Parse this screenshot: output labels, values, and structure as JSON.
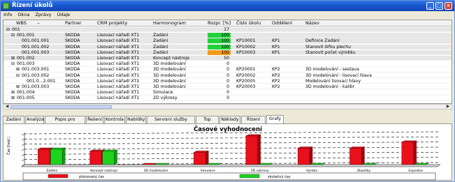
{
  "window": {
    "title": "Řízení úkolů",
    "controls": {
      "minimize": "_",
      "maximize": "□",
      "close": "×"
    }
  },
  "menu": [
    "Info",
    "Okna",
    "Zprávy",
    "Údaje"
  ],
  "grid": {
    "columns": [
      "WBS",
      "Partner",
      "CRM projekty",
      "Harmonogram",
      "Rozpr. [%]",
      "Číslo úkolu",
      "Oddělení",
      "Název"
    ],
    "rows": [
      {
        "wbs": "001",
        "partner": "",
        "crm": "",
        "harm": "",
        "pct": "17",
        "num": "",
        "odd": "",
        "nazev": "",
        "ind": 0,
        "exp": "minus",
        "sel": true
      },
      {
        "wbs": "001.001",
        "partner": "SKODA",
        "crm": "Lisovací nářadí XT1",
        "harm": "Zadání",
        "pct": "100",
        "num": "",
        "odd": "",
        "nazev": "",
        "ind": 1,
        "exp": "minus",
        "sel": true,
        "bar": "green"
      },
      {
        "wbs": "001.001.001",
        "partner": "SKODA",
        "crm": "Lisovací nářadí XT1",
        "harm": "Zadání",
        "pct": "100",
        "num": "KP10001",
        "odd": "KP1",
        "nazev": "Definice Zadání",
        "ind": 2,
        "exp": "",
        "sel": true,
        "bar": "green"
      },
      {
        "wbs": "001.001.002",
        "partner": "SKODA",
        "crm": "Lisovací nářadí XT1",
        "harm": "Zadání",
        "pct": "100",
        "num": "KP10002",
        "odd": "KP1",
        "nazev": "Stanovit šířku plechu",
        "ind": 2,
        "exp": "",
        "sel": true,
        "bar": "green"
      },
      {
        "wbs": "001.001.003",
        "partner": "SKODA",
        "crm": "Lisovací nářadí XT1",
        "harm": "Zadání",
        "pct": "100",
        "num": "KP10003",
        "odd": "KP1",
        "nazev": "Stanovit počet výrobku",
        "ind": 2,
        "exp": "",
        "sel": true,
        "bar": "orange"
      },
      {
        "wbs": "001.002",
        "partner": "SKODA",
        "crm": "Lisovací nářadí XT1",
        "harm": "Koncept nástroje",
        "pct": "50",
        "num": "",
        "odd": "",
        "nazev": "",
        "ind": 1,
        "exp": "plus",
        "sel": true
      },
      {
        "wbs": "001.003",
        "partner": "SKODA",
        "crm": "Lisovací nářadí XT1",
        "harm": "3D modelování",
        "pct": "0",
        "num": "",
        "odd": "",
        "nazev": "",
        "ind": 1,
        "exp": "minus"
      },
      {
        "wbs": "001.003.001",
        "partner": "SKODA",
        "crm": "Lisovací nářadí XT1",
        "harm": "3D modelování",
        "pct": "0",
        "num": "KP20001",
        "odd": "KP2",
        "nazev": "3D modelování - sestava",
        "ind": 2,
        "exp": "plus"
      },
      {
        "wbs": "001.003.002",
        "partner": "SKODA",
        "crm": "Lisovací nářadí XT1",
        "harm": "3D modelování",
        "pct": "0",
        "num": "KP20002",
        "odd": "KP2",
        "nazev": "3D modelování - lisovací hlava",
        "ind": 2,
        "exp": "minus"
      },
      {
        "wbs": "001.0...2.001",
        "partner": "SKODA",
        "crm": "Lisovací nářadí XT1",
        "harm": "3D modelování",
        "pct": "0",
        "num": "KP20005",
        "odd": "KP2",
        "nazev": "Modelování lisovací hlavy",
        "ind": 3,
        "exp": ""
      },
      {
        "wbs": "001.003.003",
        "partner": "SKODA",
        "crm": "Lisovací nářadí XT1",
        "harm": "3D modelování",
        "pct": "0",
        "num": "KP20003",
        "odd": "KP2",
        "nazev": "3D modelování - kalibr",
        "ind": 2,
        "exp": "plus"
      },
      {
        "wbs": "001.004",
        "partner": "SKODA",
        "crm": "Lisovací nářadí XT1",
        "harm": "Simulace",
        "pct": "0",
        "num": "",
        "odd": "",
        "nazev": "",
        "ind": 1,
        "exp": "plus"
      },
      {
        "wbs": "001.005",
        "partner": "SKODA",
        "crm": "Lisovací nářadí XT1",
        "harm": "2D výkresy",
        "pct": "0",
        "num": "",
        "odd": "",
        "nazev": "",
        "ind": 1,
        "exp": "plus"
      }
    ]
  },
  "tabs": [
    "Zadání",
    "Analýza",
    "Popis pro zákazníka",
    "Řešení",
    "Kontrola",
    "Nabídky",
    "Servisní služby zdarma",
    "Top úkoly",
    "Náklady",
    "Řízení rizik",
    "Grafy"
  ],
  "active_tab": "Grafy",
  "chart_data": {
    "type": "bar",
    "title": "Časové vyhodnocení",
    "ylabel": "Čas [hod.]",
    "categories": [
      "Zadání",
      "Koncept nástroje",
      "3D modelování",
      "Simulace",
      "2D výkresy",
      "Výroba",
      "Zkoušky",
      "Expedice"
    ],
    "series": [
      {
        "name": "plánovaný čas",
        "color": "#e8101a",
        "values": [
          15,
          13,
          0,
          12,
          28,
          16,
          16,
          22
        ]
      },
      {
        "name": "skutečný čas",
        "color": "#1ed21e",
        "values": [
          15,
          13,
          0,
          0,
          0,
          0,
          0,
          0
        ]
      }
    ],
    "ylim": [
      0,
      30
    ],
    "legend": "bottom"
  },
  "colors": {
    "title": "#1550c8",
    "green": "#22d23a",
    "orange": "#f29a1c",
    "red": "#e8101a"
  }
}
